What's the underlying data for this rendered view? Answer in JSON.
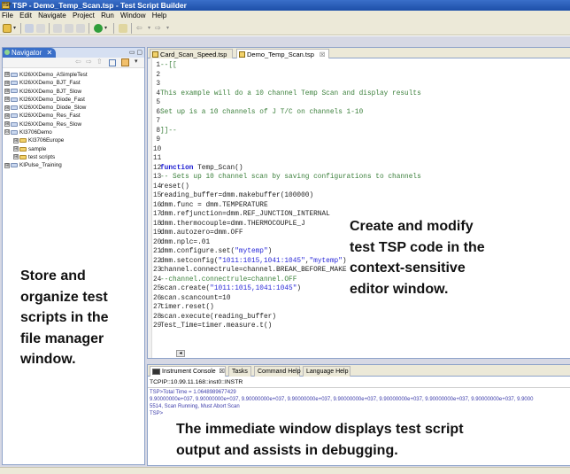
{
  "window": {
    "title": "TSP - Demo_Temp_Scan.tsp - Test Script Builder"
  },
  "menu": [
    "File",
    "Edit",
    "Navigate",
    "Project",
    "Run",
    "Window",
    "Help"
  ],
  "navigator": {
    "tab_label": "Navigator",
    "tab_close": "✕",
    "items": [
      {
        "label": "KI26XXDemo_ASimpleTest",
        "expander": "⊞",
        "level": 0
      },
      {
        "label": "KI26XXDemo_BJT_Fast",
        "expander": "⊞",
        "level": 0
      },
      {
        "label": "KI26XXDemo_BJT_Slow",
        "expander": "⊞",
        "level": 0
      },
      {
        "label": "KI26XXDemo_Diode_Fast",
        "expander": "⊞",
        "level": 0
      },
      {
        "label": "KI26XXDemo_Diode_Slow",
        "expander": "⊞",
        "level": 0
      },
      {
        "label": "KI26XXDemo_Res_Fast",
        "expander": "⊞",
        "level": 0
      },
      {
        "label": "KI26XXDemo_Res_Slow",
        "expander": "⊞",
        "level": 0
      },
      {
        "label": "KI3706Demo",
        "expander": "⊟",
        "level": 0
      },
      {
        "label": "KI3706Europe",
        "expander": "⊞",
        "level": 1
      },
      {
        "label": "sample",
        "expander": "⊞",
        "level": 1
      },
      {
        "label": "test scripts",
        "expander": "⊞",
        "level": 1
      },
      {
        "label": "KIPulse_Training",
        "expander": "⊞",
        "level": 0
      }
    ],
    "note": [
      "Store and",
      "organize test",
      "scripts in the",
      "file manager",
      "window."
    ]
  },
  "editor": {
    "tabs": [
      {
        "label": "Card_Scan_Speed.tsp",
        "active": false
      },
      {
        "label": "Demo_Temp_Scan.tsp",
        "active": true,
        "close": "☒"
      }
    ],
    "lines": [
      {
        "n": "1",
        "parts": [
          {
            "t": "--[[",
            "c": "comment"
          }
        ]
      },
      {
        "n": "2",
        "parts": []
      },
      {
        "n": "3",
        "parts": []
      },
      {
        "n": "4",
        "parts": [
          {
            "t": "This example will do a 10 channel Temp Scan and display results",
            "c": "comment"
          }
        ]
      },
      {
        "n": "5",
        "parts": []
      },
      {
        "n": "6",
        "parts": [
          {
            "t": "Set up is a 10 channels of J T/C on channels 1-10",
            "c": "comment"
          }
        ]
      },
      {
        "n": "7",
        "parts": []
      },
      {
        "n": "8",
        "parts": [
          {
            "t": "]]--",
            "c": "comment"
          }
        ]
      },
      {
        "n": "9",
        "parts": []
      },
      {
        "n": "10",
        "parts": []
      },
      {
        "n": "11",
        "parts": []
      },
      {
        "n": "12",
        "parts": [
          {
            "t": "function",
            "c": "kw"
          },
          {
            "t": " Temp_Scan()",
            "c": "plain"
          }
        ]
      },
      {
        "n": "13",
        "parts": [
          {
            "t": "-- Sets up 10 channel scan by saving configurations to channels",
            "c": "comment"
          }
        ]
      },
      {
        "n": "14",
        "parts": [
          {
            "t": "reset()",
            "c": "plain"
          }
        ]
      },
      {
        "n": "15",
        "parts": [
          {
            "t": "reading_buffer=dmm.makebuffer(100000)",
            "c": "plain"
          }
        ]
      },
      {
        "n": "16",
        "parts": [
          {
            "t": "dmm.func = dmm.TEMPERATURE",
            "c": "plain"
          }
        ]
      },
      {
        "n": "17",
        "parts": [
          {
            "t": "dmm.refjunction=dmm.REF_JUNCTION_INTERNAL",
            "c": "plain"
          }
        ]
      },
      {
        "n": "18",
        "parts": [
          {
            "t": "dmm.thermocouple=dmm.THERMOCOUPLE_J",
            "c": "plain"
          }
        ]
      },
      {
        "n": "19",
        "parts": [
          {
            "t": "dmm.autozero=dmm.OFF",
            "c": "plain"
          }
        ]
      },
      {
        "n": "20",
        "parts": [
          {
            "t": "dmm.nplc=.01",
            "c": "plain"
          }
        ]
      },
      {
        "n": "21",
        "parts": [
          {
            "t": "dmm.configure.set(",
            "c": "plain"
          },
          {
            "t": "\"mytemp\"",
            "c": "str"
          },
          {
            "t": ")",
            "c": "plain"
          }
        ]
      },
      {
        "n": "22",
        "parts": [
          {
            "t": "dmm.setconfig(",
            "c": "plain"
          },
          {
            "t": "\"1011:1015,1041:1045\"",
            "c": "str"
          },
          {
            "t": ",",
            "c": "plain"
          },
          {
            "t": "\"mytemp\"",
            "c": "str"
          },
          {
            "t": ")",
            "c": "plain"
          }
        ]
      },
      {
        "n": "23",
        "parts": [
          {
            "t": "channel.connectrule=channel.BREAK_BEFORE_MAKE",
            "c": "plain"
          }
        ]
      },
      {
        "n": "24",
        "parts": [
          {
            "t": "--channel.connectrule=channel.OFF",
            "c": "comment"
          }
        ]
      },
      {
        "n": "25",
        "parts": [
          {
            "t": "scan.create(",
            "c": "plain"
          },
          {
            "t": "\"1011:1015,1041:1045\"",
            "c": "str"
          },
          {
            "t": ")",
            "c": "plain"
          }
        ]
      },
      {
        "n": "26",
        "parts": [
          {
            "t": "scan.scancount=10",
            "c": "plain"
          }
        ]
      },
      {
        "n": "27",
        "parts": [
          {
            "t": "timer.reset()",
            "c": "plain"
          }
        ]
      },
      {
        "n": "28",
        "parts": [
          {
            "t": "scan.execute(reading_buffer)",
            "c": "plain"
          }
        ]
      },
      {
        "n": "29",
        "parts": [
          {
            "t": "Test_Time=timer.measure.t()",
            "c": "plain"
          }
        ]
      }
    ],
    "note": [
      "Create and modify",
      "test TSP code in the",
      "context-sensitive",
      "editor window."
    ]
  },
  "console": {
    "tabs": [
      {
        "label": "Instrument Console",
        "active": true,
        "close": "☒"
      },
      {
        "label": "Tasks",
        "active": false
      },
      {
        "label": "Command Help",
        "active": false
      },
      {
        "label": "Language Help",
        "active": false
      }
    ],
    "connection": "TCPIP::10.99.11.168::inst0::INSTR",
    "output": [
      "TSP>Total Time = 1.0648989677429",
      "9.90000000e+037, 9.90000000e+037, 9.90000000e+037, 9.90000000e+037, 9.90000000e+037, 9.90000000e+037, 9.90000000e+037, 9.90000000e+037, 9.9000",
      "5514, Scan Running, Must Abort Scan",
      "TSP>"
    ],
    "note": [
      "The immediate window displays test script",
      "output and assists in debugging."
    ]
  },
  "colors": {
    "titlebar": "#1d4fa8",
    "comment": "#3a7f3a",
    "keyword": "#1a1ad0",
    "string": "#2a2ad8"
  }
}
